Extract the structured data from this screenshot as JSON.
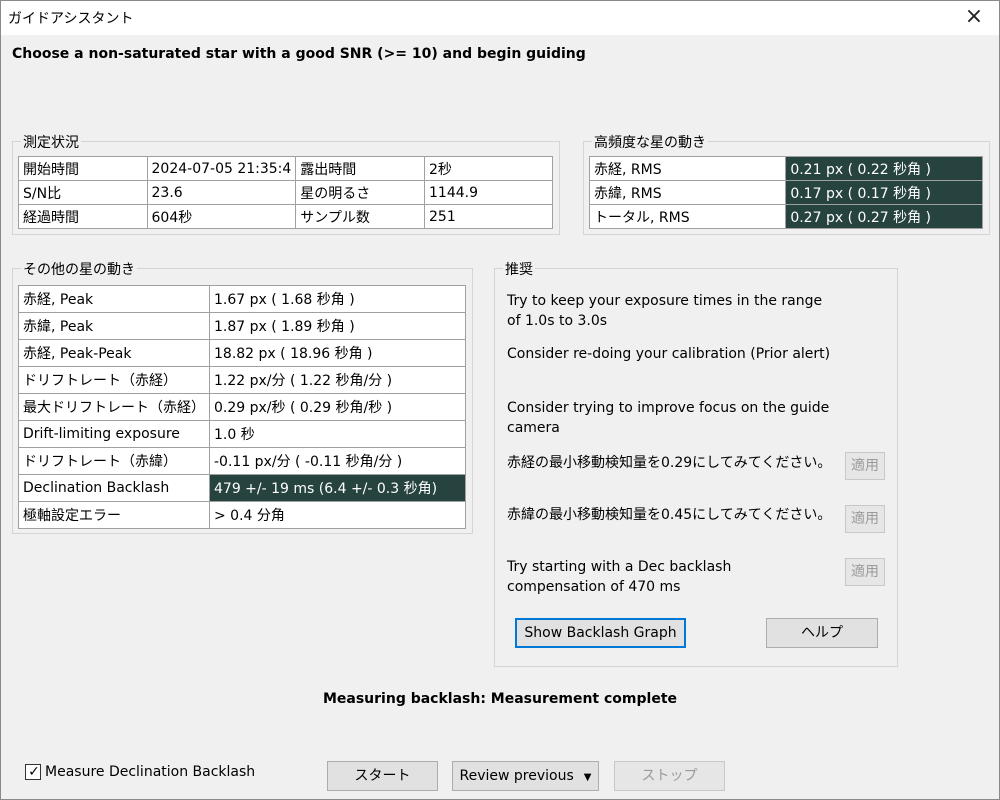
{
  "window": {
    "title": "ガイドアシスタント",
    "close_icon": "×"
  },
  "instruction": "Choose a non-saturated star with a good SNR (>= 10) and begin guiding",
  "measurement": {
    "title": "測定状況",
    "rows": [
      [
        "開始時間",
        "2024-07-05 21:35:4",
        "露出時間",
        "2秒"
      ],
      [
        "S/N比",
        "23.6",
        "星の明るさ",
        "1144.9"
      ],
      [
        "経過時間",
        "604秒",
        "サンプル数",
        "251"
      ]
    ]
  },
  "high_freq": {
    "title": "高頻度な星の動き",
    "rows": [
      [
        "赤経, RMS",
        "0.21 px (  0.22 秒角 )"
      ],
      [
        "赤緯, RMS",
        "0.17 px (  0.17 秒角 )"
      ],
      [
        "トータル, RMS",
        "0.27 px (  0.27 秒角 )"
      ]
    ]
  },
  "other_motion": {
    "title": "その他の星の動き",
    "rows": [
      [
        "赤経, Peak",
        "  1.67 px (  1.68 秒角 )"
      ],
      [
        "赤緯, Peak",
        "  1.87 px (  1.89 秒角 )"
      ],
      [
        "赤経, Peak-Peak",
        "18.82 px ( 18.96 秒角 )"
      ],
      [
        "ドリフトレート（赤経）",
        "  1.22 px/分 (  1.22 秒角/分 )"
      ],
      [
        "最大ドリフトレート（赤経）",
        " 0.29 px/秒 (  0.29 秒角/秒 )"
      ],
      [
        "Drift-limiting exposure",
        "  1.0 秒"
      ],
      [
        "ドリフトレート（赤緯）",
        "-0.11 px/分 ( -0.11 秒角/分 )"
      ],
      [
        "Declination Backlash",
        "479  +/-  19 ms (6.4  +/-  0.3 秒角)"
      ],
      [
        "極軸設定エラー",
        ">  0.4 分角"
      ]
    ]
  },
  "recommendations": {
    "title": "推奨",
    "items": [
      "Try to keep your exposure times in the range of 1.0s to 3.0s",
      "Consider re-doing your calibration (Prior alert)",
      "Consider trying to improve focus on the guide camera",
      "赤経の最小移動検知量を0.29にしてみてください。",
      "赤緯の最小移動検知量を0.45にしてみてください。",
      "Try starting with a Dec backlash compensation of 470 ms"
    ],
    "apply_label": "適用",
    "show_backlash_label": "Show Backlash Graph",
    "help_label": "ヘルプ"
  },
  "status": "Measuring backlash: Measurement complete",
  "footer": {
    "measure_backlash_label": "Measure Declination Backlash",
    "measure_backlash_checked": true,
    "check_mark": "✓",
    "start_label": "スタート",
    "review_label": "Review previous",
    "dropdown_arrow": "▼",
    "stop_label": "ストップ"
  },
  "colors": {
    "highlight": "#26433f",
    "accent_border": "#0078d7"
  }
}
